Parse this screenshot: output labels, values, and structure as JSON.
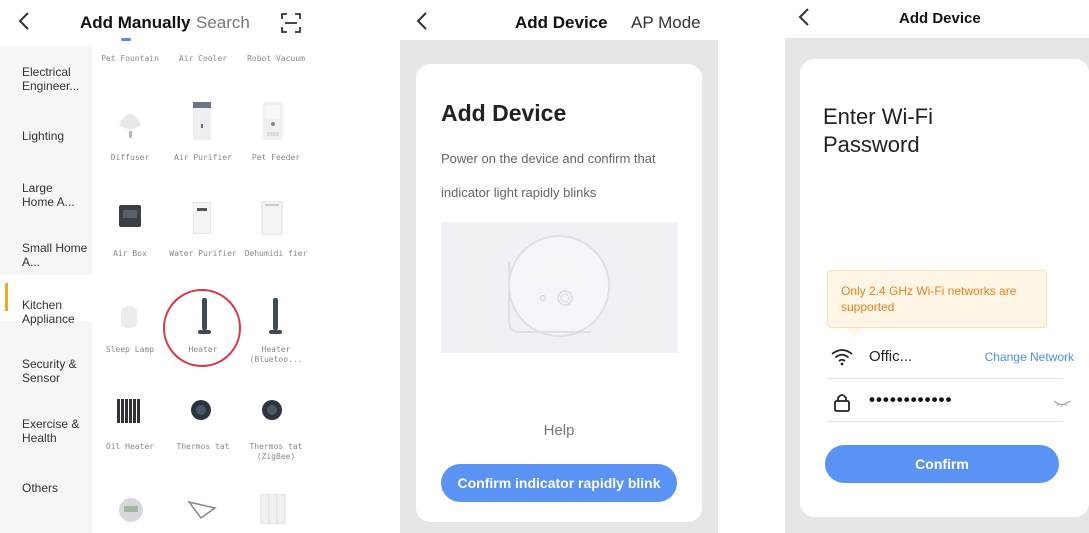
{
  "panel1": {
    "back_icon": "chevron-left-icon",
    "tabs": [
      {
        "label": "Add Manually",
        "active": true
      },
      {
        "label": "Search "
      }
    ],
    "scan_icon": "scan-icon",
    "categories": [
      {
        "label": "Electrical Engineer..."
      },
      {
        "label": "Lighting"
      },
      {
        "label": "Large Home A..."
      },
      {
        "label": "Small Home A...",
        "active": true
      },
      {
        "label": "Kitchen Appliance"
      },
      {
        "label": "Security & Sensor"
      },
      {
        "label": "Exercise & Health"
      },
      {
        "label": "Others"
      }
    ],
    "devices": [
      {
        "label": "Pet Fountain"
      },
      {
        "label": "Air Cooler"
      },
      {
        "label": "Robot Vacuum"
      },
      {
        "label": "Diffuser"
      },
      {
        "label": "Air Purifier"
      },
      {
        "label": "Pet Feeder"
      },
      {
        "label": "Air Box"
      },
      {
        "label": "Water Purifier"
      },
      {
        "label": "Dehumidi fier"
      },
      {
        "label": "Sleep Lamp"
      },
      {
        "label": "Heater",
        "highlighted": true
      },
      {
        "label": "Heater (Bluetoo..."
      },
      {
        "label": "Oil Heater"
      },
      {
        "label": "Thermos tat"
      },
      {
        "label": "Thermos tat (ZigBee)"
      }
    ],
    "accent": "#4a8ef5",
    "active_marker": "#f5a623",
    "highlight_circle": "#d9363e"
  },
  "panel2": {
    "title": "Add Device",
    "mode_tab": "AP Mode",
    "card_title": "Add Device",
    "description": "Power on the device and confirm that indicator light rapidly blinks",
    "help": "Help",
    "confirm_button": "Confirm indicator rapidly blink",
    "button_color": "#5b93f5"
  },
  "panel3": {
    "title": "Add Device",
    "card_title": "Enter Wi-Fi Password",
    "warning": "Only 2.4 GHz Wi-Fi networks are supported",
    "network_name": "Offic...",
    "change_network": "Change Network",
    "password_mask": "••••••••••••",
    "wifi_icon": "wifi-icon",
    "lock_icon": "lock-icon",
    "eye_icon": "eye-closed-icon",
    "confirm_button": "Confirm",
    "warning_color": "#e8801e"
  }
}
